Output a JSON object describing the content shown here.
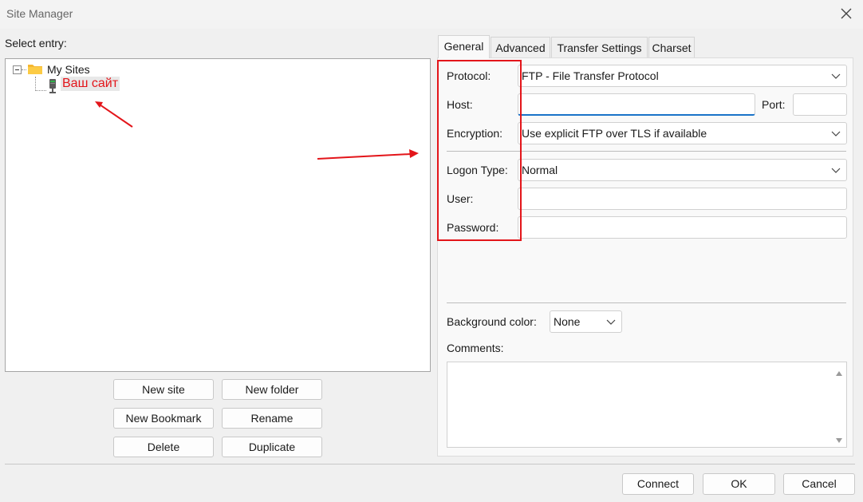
{
  "window": {
    "title": "Site Manager"
  },
  "left": {
    "select_entry_label": "Select entry:",
    "tree": {
      "root_label": "My Sites",
      "site_label": "Ваш сайт"
    },
    "buttons": {
      "new_site": "New site",
      "new_folder": "New folder",
      "new_bookmark": "New Bookmark",
      "rename": "Rename",
      "delete": "Delete",
      "duplicate": "Duplicate"
    }
  },
  "tabs": {
    "general": "General",
    "advanced": "Advanced",
    "transfer_settings": "Transfer Settings",
    "charset": "Charset"
  },
  "general": {
    "protocol_label": "Protocol:",
    "protocol_value": "FTP - File Transfer Protocol",
    "host_label": "Host:",
    "host_value": "",
    "port_label": "Port:",
    "port_value": "",
    "encryption_label": "Encryption:",
    "encryption_value": "Use explicit FTP over TLS if available",
    "logon_type_label": "Logon Type:",
    "logon_type_value": "Normal",
    "user_label": "User:",
    "user_value": "",
    "password_label": "Password:",
    "password_value": "",
    "bg_color_label": "Background color:",
    "bg_color_value": "None",
    "comments_label": "Comments:",
    "comments_value": ""
  },
  "footer": {
    "connect": "Connect",
    "ok": "OK",
    "cancel": "Cancel"
  },
  "colors": {
    "annotation_red": "#e3151a",
    "highlight_text_red": "#e3151a"
  }
}
